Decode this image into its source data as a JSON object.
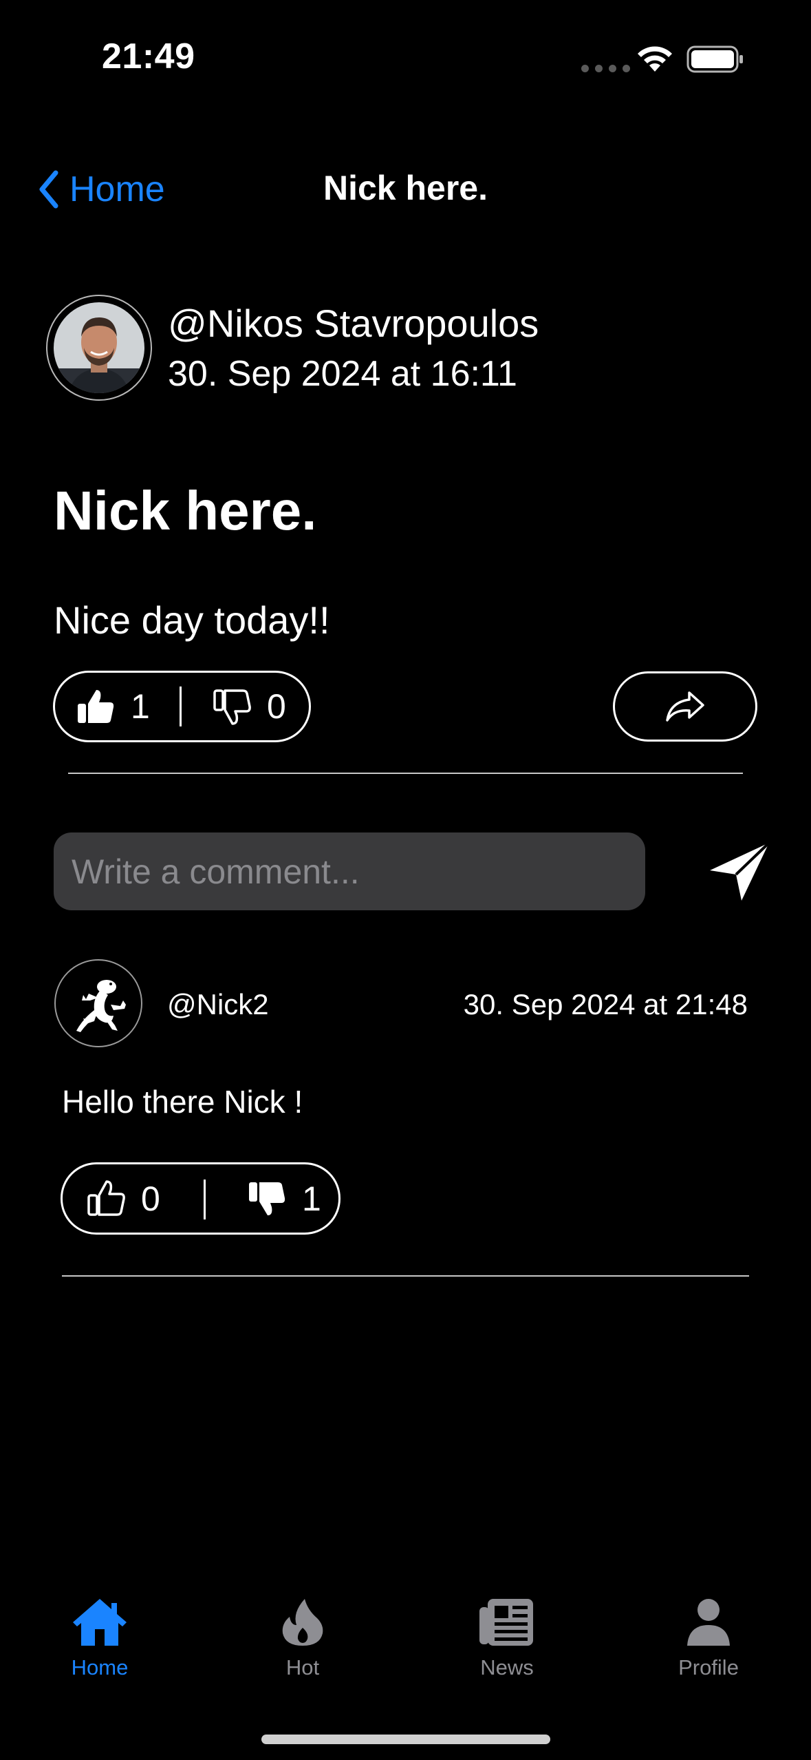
{
  "status_bar": {
    "time": "21:49"
  },
  "nav": {
    "back_label": "Home",
    "title": "Nick here."
  },
  "post": {
    "author": "@Nikos Stavropoulos",
    "date": "30. Sep 2024 at 16:11",
    "title": "Nick here.",
    "body": "Nice day today!!",
    "likes": "1",
    "dislikes": "0"
  },
  "comment_form": {
    "placeholder": "Write a comment..."
  },
  "comments": [
    {
      "user": "@Nick2",
      "date": "30. Sep 2024 at 21:48",
      "text": "Hello there Nick !",
      "likes": "0",
      "dislikes": "1"
    }
  ],
  "tabs": [
    {
      "label": "Home",
      "icon": "house-icon",
      "active": true
    },
    {
      "label": "Hot",
      "icon": "flame-icon",
      "active": false
    },
    {
      "label": "News",
      "icon": "newspaper-icon",
      "active": false
    },
    {
      "label": "Profile",
      "icon": "person-icon",
      "active": false
    }
  ],
  "colors": {
    "accent": "#1a84ff",
    "inactive_tab": "#8e8e93",
    "input_bg": "#3a3a3c"
  }
}
